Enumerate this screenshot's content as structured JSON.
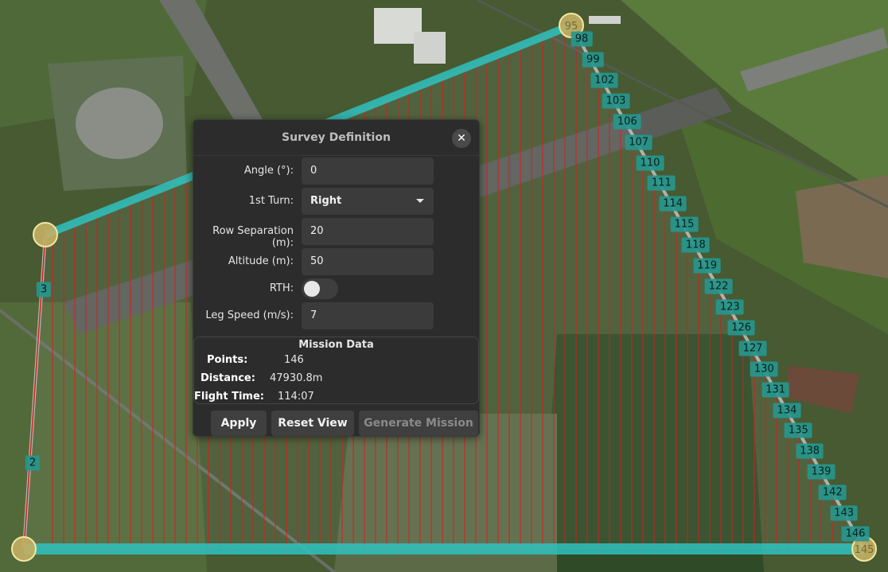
{
  "map": {
    "corners": [
      {
        "label": "",
        "fx": 0.051,
        "fy": 0.412
      },
      {
        "label": "95",
        "fx": 0.643,
        "fy": 0.044
      },
      {
        "label": "",
        "fx": 0.027,
        "fy": 0.961
      },
      {
        "label": "145",
        "fx": 0.973,
        "fy": 0.961
      }
    ],
    "left_markers": [
      {
        "label": "3"
      },
      {
        "label": "2"
      }
    ],
    "right_markers": [
      "98",
      "99",
      "102",
      "103",
      "106",
      "107",
      "110",
      "111",
      "114",
      "115",
      "118",
      "119",
      "122",
      "123",
      "126",
      "127",
      "130",
      "131",
      "134",
      "135",
      "138",
      "139",
      "142",
      "143",
      "146"
    ]
  },
  "dialog": {
    "title": "Survey Definition",
    "close_icon": "✕",
    "fields": {
      "angle_label": "Angle (°):",
      "angle_value": "0",
      "first_turn_label": "1st Turn:",
      "first_turn_value": "Right",
      "row_sep_label": "Row Separation (m):",
      "row_sep_value": "20",
      "altitude_label": "Altitude (m):",
      "altitude_value": "50",
      "rth_label": "RTH:",
      "rth_on": false,
      "leg_speed_label": "Leg Speed (m/s):",
      "leg_speed_value": "7"
    },
    "mission": {
      "title": "Mission Data",
      "points_label": "Points:",
      "points_value": "146",
      "distance_label": "Distance:",
      "distance_value": "47930.8m",
      "flight_time_label": "Flight Time:",
      "flight_time_value": "114:07"
    },
    "buttons": {
      "apply": "Apply",
      "reset_view": "Reset View",
      "generate": "Generate Mission"
    }
  }
}
